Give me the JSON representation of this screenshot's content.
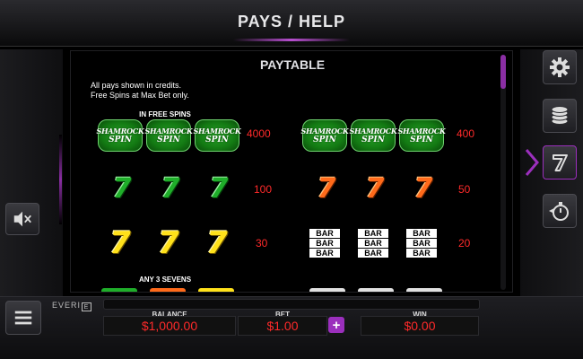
{
  "header": {
    "title": "PAYS / HELP"
  },
  "paytable": {
    "title": "PAYTABLE",
    "note_line1": "All pays shown in credits.",
    "note_line2": "Free Spins at Max Bet only.",
    "free_spins_label": "IN FREE SPINS",
    "any_sevens_label": "ANY 3 SEVENS",
    "symbol_text": {
      "shamrock_line1": "SHAMROCK",
      "shamrock_line2": "SPIN",
      "seven": "7",
      "bar": "BAR"
    },
    "pays": {
      "shamrock_free_spins": "4000",
      "shamrock": "400",
      "green_sevens": "100",
      "orange_sevens": "50",
      "yellow_sevens": "30",
      "triple_bar": "20"
    },
    "scroll_position": 0
  },
  "buttons": {
    "settings_icon": "gear-icon",
    "denomination_icon": "coin-stack-icon",
    "paytable_icon": "seven-icon",
    "autoplay_icon": "stopwatch-icon",
    "mute_icon": "speaker-mute-icon",
    "menu_icon": "hamburger-icon"
  },
  "footer": {
    "brand": "EVERI",
    "brand_box": "E",
    "balance_label": "BALANCE",
    "balance_value": "$1,000.00",
    "bet_label": "BET",
    "bet_value": "$1.00",
    "bet_plus": "+",
    "win_label": "WIN",
    "win_value": "$0.00"
  },
  "colors": {
    "accent": "#9b2fbd",
    "pay_text": "#ff2a2a",
    "meter_text": "#ff2a2a"
  }
}
